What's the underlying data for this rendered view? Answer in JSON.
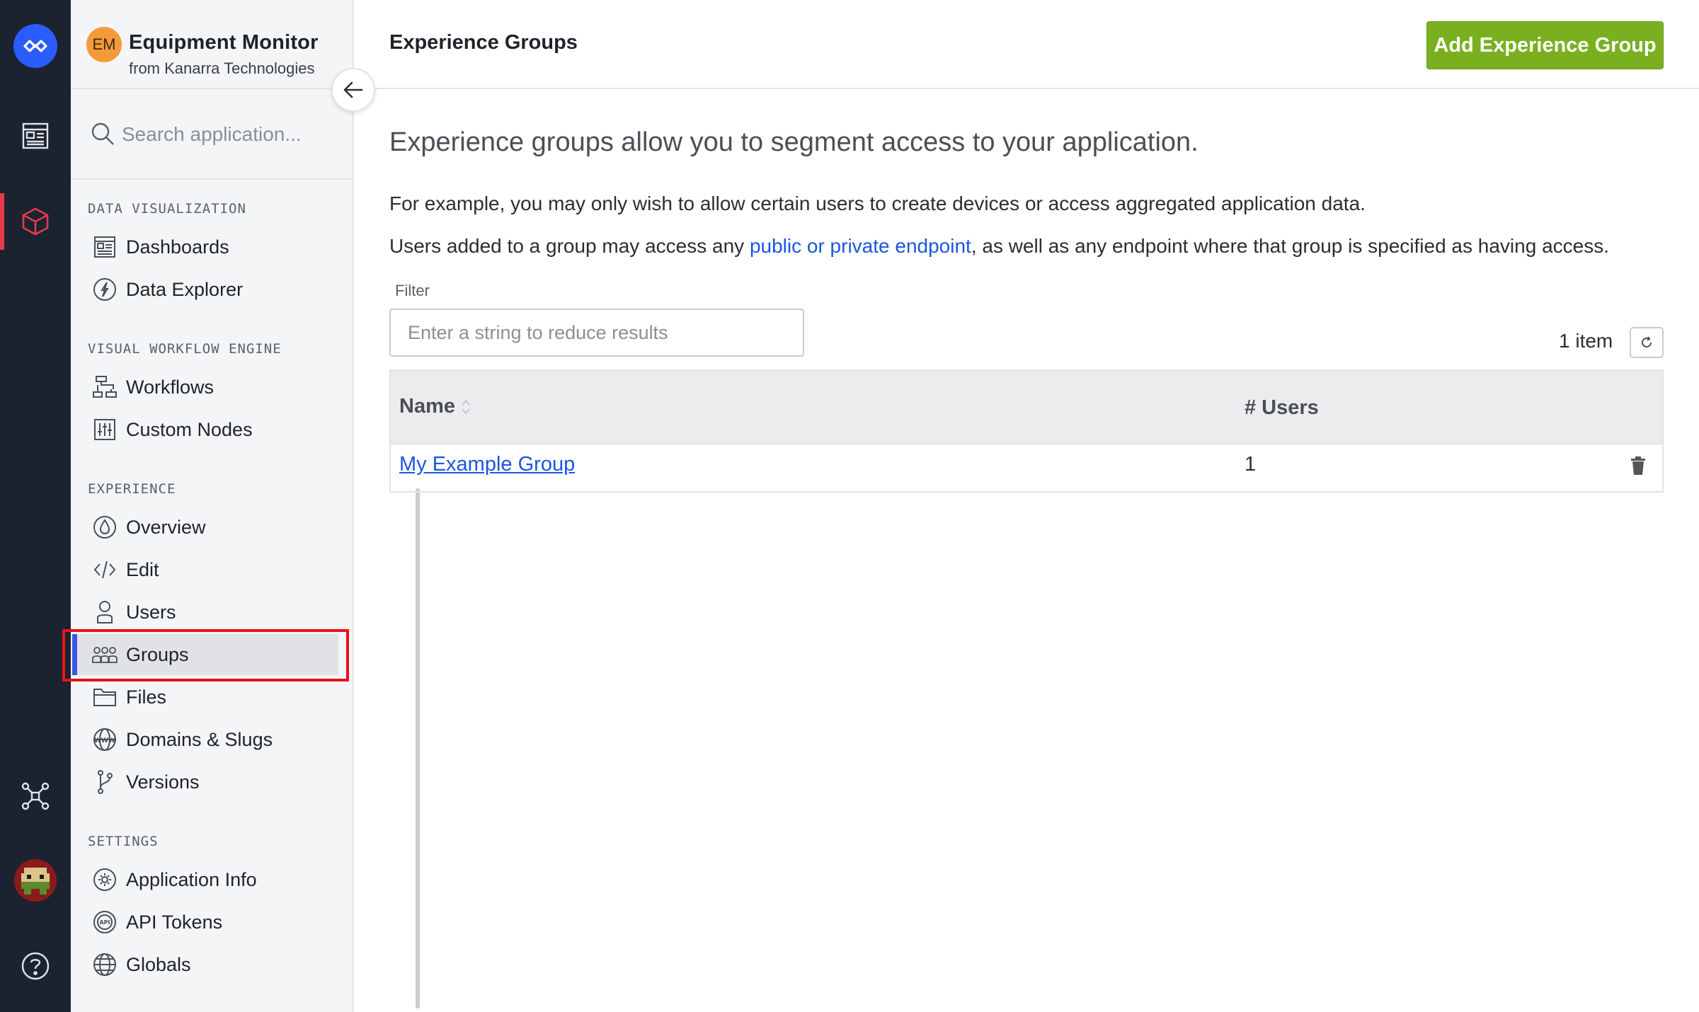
{
  "app": {
    "badge": "EM",
    "name": "Equipment Monitor",
    "org": "from Kanarra Technologies"
  },
  "sidebar": {
    "search_placeholder": "Search application...",
    "sections": [
      {
        "label": "DATA VISUALIZATION",
        "items": [
          {
            "label": "Dashboards",
            "icon": "dashboard-icon"
          },
          {
            "label": "Data Explorer",
            "icon": "compass-icon"
          }
        ]
      },
      {
        "label": "VISUAL WORKFLOW ENGINE",
        "items": [
          {
            "label": "Workflows",
            "icon": "workflow-icon"
          },
          {
            "label": "Custom Nodes",
            "icon": "sliders-icon"
          }
        ]
      },
      {
        "label": "EXPERIENCE",
        "items": [
          {
            "label": "Overview",
            "icon": "drop-icon"
          },
          {
            "label": "Edit",
            "icon": "code-icon"
          },
          {
            "label": "Users",
            "icon": "user-icon"
          },
          {
            "label": "Groups",
            "icon": "group-icon"
          },
          {
            "label": "Files",
            "icon": "folder-icon"
          },
          {
            "label": "Domains & Slugs",
            "icon": "www-icon"
          },
          {
            "label": "Versions",
            "icon": "branch-icon"
          }
        ]
      },
      {
        "label": "SETTINGS",
        "items": [
          {
            "label": "Application Info",
            "icon": "gear-icon"
          },
          {
            "label": "API Tokens",
            "icon": "api-icon"
          },
          {
            "label": "Globals",
            "icon": "globe-icon"
          }
        ]
      }
    ],
    "active_item": "Groups"
  },
  "header": {
    "title": "Experience Groups",
    "add_button": "Add Experience Group"
  },
  "content": {
    "intro": "Experience groups allow you to segment access to your application.",
    "para1": "For example, you may only wish to allow certain users to create devices or access aggregated application data.",
    "para2_before": "Users added to a group may access any ",
    "para2_link": "public or private endpoint",
    "para2_after": ", as well as any endpoint where that group is specified as having access.",
    "filter_label": "Filter",
    "filter_placeholder": "Enter a string to reduce results",
    "filter_value": "",
    "item_count": "1 item"
  },
  "table": {
    "columns": [
      "Name",
      "# Users"
    ],
    "rows": [
      {
        "name": "My Example Group",
        "users": "1"
      }
    ]
  },
  "colors": {
    "accent": "#3b55e6",
    "add_button": "#7ab020",
    "link": "#1c55e0",
    "rail": "#1b2330",
    "rail_active": "#e63a4b",
    "highlight": "#e8121c"
  }
}
